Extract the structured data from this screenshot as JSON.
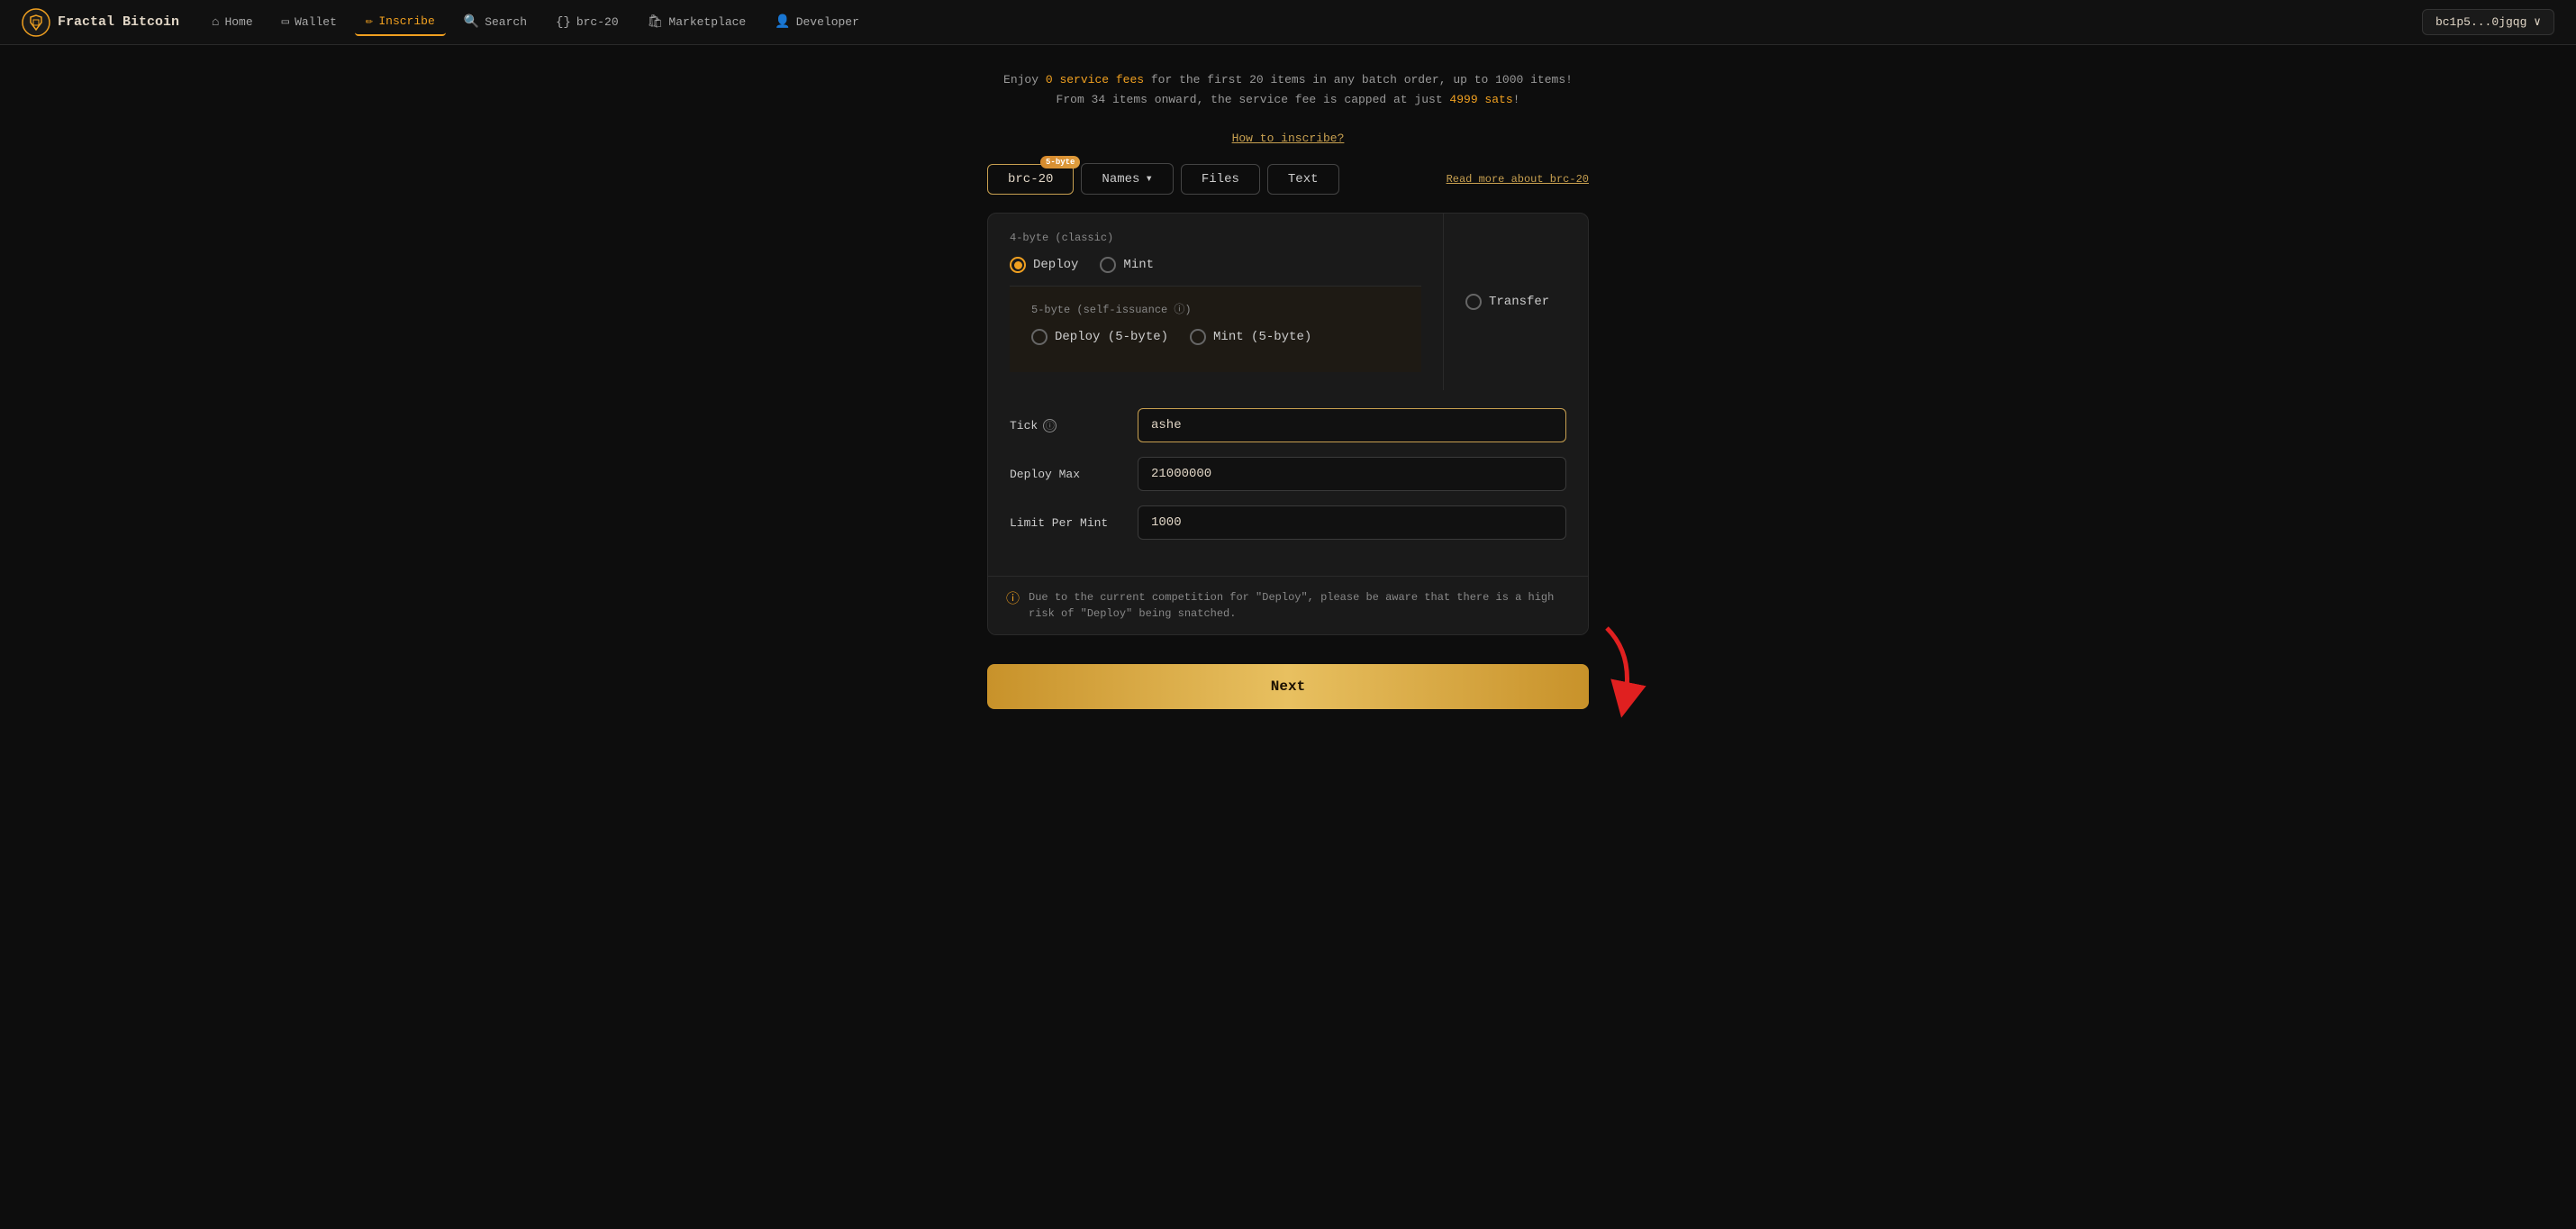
{
  "nav": {
    "logo_text": "Fractal Bitcoin",
    "items": [
      {
        "id": "home",
        "label": "Home",
        "icon": "🏠",
        "active": false
      },
      {
        "id": "wallet",
        "label": "Wallet",
        "icon": "🗒️",
        "active": false
      },
      {
        "id": "inscribe",
        "label": "Inscribe",
        "icon": "✏️",
        "active": true
      },
      {
        "id": "search",
        "label": "Search",
        "icon": "🔍",
        "active": false
      },
      {
        "id": "brc20",
        "label": "brc-20",
        "icon": "{}",
        "active": false
      },
      {
        "id": "marketplace",
        "label": "Marketplace",
        "icon": "🏪",
        "active": false
      },
      {
        "id": "developer",
        "label": "Developer",
        "icon": "👤",
        "active": false
      }
    ],
    "wallet_address": "bc1p5...0jgqg ∨"
  },
  "promo": {
    "line1_pre": "Enjoy ",
    "line1_highlight": "0 service fees",
    "line1_post": " for the first 20 items in any batch order, up to 1000 items!",
    "line2_pre": "From 34 items onward, the service fee is capped at just ",
    "line2_highlight": "4999 sats",
    "line2_post": "!",
    "how_to_link": "How to inscribe?"
  },
  "tabs": {
    "brc20": {
      "label": "brc-20",
      "badge": "5-byte",
      "active": true
    },
    "names": {
      "label": "Names",
      "active": false
    },
    "files": {
      "label": "Files",
      "active": false
    },
    "text": {
      "label": "Text",
      "active": false
    },
    "read_more": "Read more about brc-20"
  },
  "operations": {
    "classic_label": "4-byte (classic)",
    "five_byte_label": "5-byte (self-issuance ⓘ)",
    "options": [
      {
        "id": "deploy",
        "label": "Deploy",
        "checked": true
      },
      {
        "id": "mint",
        "label": "Mint",
        "checked": false
      },
      {
        "id": "transfer",
        "label": "Transfer",
        "checked": false
      },
      {
        "id": "deploy_5byte",
        "label": "Deploy (5-byte)",
        "checked": false
      },
      {
        "id": "mint_5byte",
        "label": "Mint (5-byte)",
        "checked": false
      }
    ]
  },
  "form": {
    "tick_label": "Tick",
    "tick_value": "ashe",
    "tick_placeholder": "",
    "deploy_max_label": "Deploy Max",
    "deploy_max_value": "21000000",
    "limit_per_mint_label": "Limit Per Mint",
    "limit_per_mint_value": "1000",
    "warning_text": "Due to the current competition for \"Deploy\", please be aware that there is a high risk of \"Deploy\" being snatched.",
    "next_button": "Next"
  }
}
